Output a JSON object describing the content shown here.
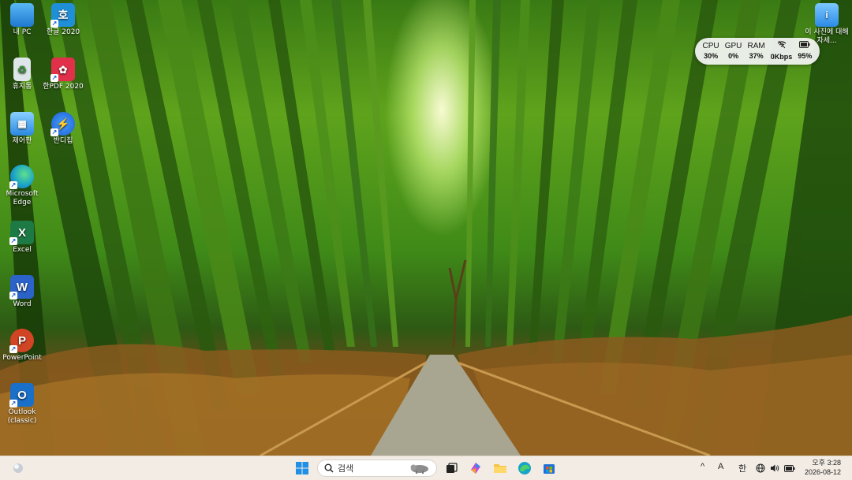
{
  "desktop_icons": [
    {
      "label": "내 PC",
      "icon": "monitor-icon",
      "color": "#2f8fe0"
    },
    {
      "label": "한글 2020",
      "icon": "hangul-icon",
      "color": "#1f8fd8"
    },
    {
      "label": "휴지통",
      "icon": "recycle-bin-icon",
      "color": "#cfd8e0"
    },
    {
      "label": "한PDF 2020",
      "icon": "hanpdf-icon",
      "color": "#e0304a"
    },
    {
      "label": "제어판",
      "icon": "control-panel-icon",
      "color": "#3a9ae8"
    },
    {
      "label": "반디집",
      "icon": "bandizip-icon",
      "color": "#2a7de0"
    },
    {
      "label": "Microsoft Edge",
      "icon": "edge-icon",
      "color": "#1aa3c8"
    },
    {
      "label": "Excel",
      "icon": "excel-icon",
      "color": "#1d7a44",
      "glyph": "X"
    },
    {
      "label": "Word",
      "icon": "word-icon",
      "color": "#2b63c8",
      "glyph": "W"
    },
    {
      "label": "PowerPoint",
      "icon": "powerpoint-icon",
      "color": "#d14424",
      "glyph": "P"
    },
    {
      "label": "Outlook (classic)",
      "icon": "outlook-icon",
      "color": "#1a6fc8",
      "glyph": "O"
    },
    {
      "label": "이 사진에 대해 자세...",
      "icon": "photo-info-icon",
      "color": "#2b8ae6"
    }
  ],
  "system_monitor": {
    "cpu_label": "CPU",
    "cpu_value": "30%",
    "gpu_label": "GPU",
    "gpu_value": "0%",
    "ram_label": "RAM",
    "ram_value": "37%",
    "net_icon": "wifi-off-icon",
    "net_value": "0Kbps",
    "battery_icon": "battery-icon",
    "battery_value": "95%"
  },
  "taskbar": {
    "search_placeholder": "검색",
    "apps": [
      "start-icon",
      "task-view-icon",
      "copilot-icon",
      "file-explorer-icon",
      "edge-icon",
      "store-icon"
    ],
    "tray": {
      "chevron": "^",
      "ime_mode": "A",
      "ime_lang": "한",
      "time": "오후 3:28",
      "date": "2026-08-12"
    }
  }
}
